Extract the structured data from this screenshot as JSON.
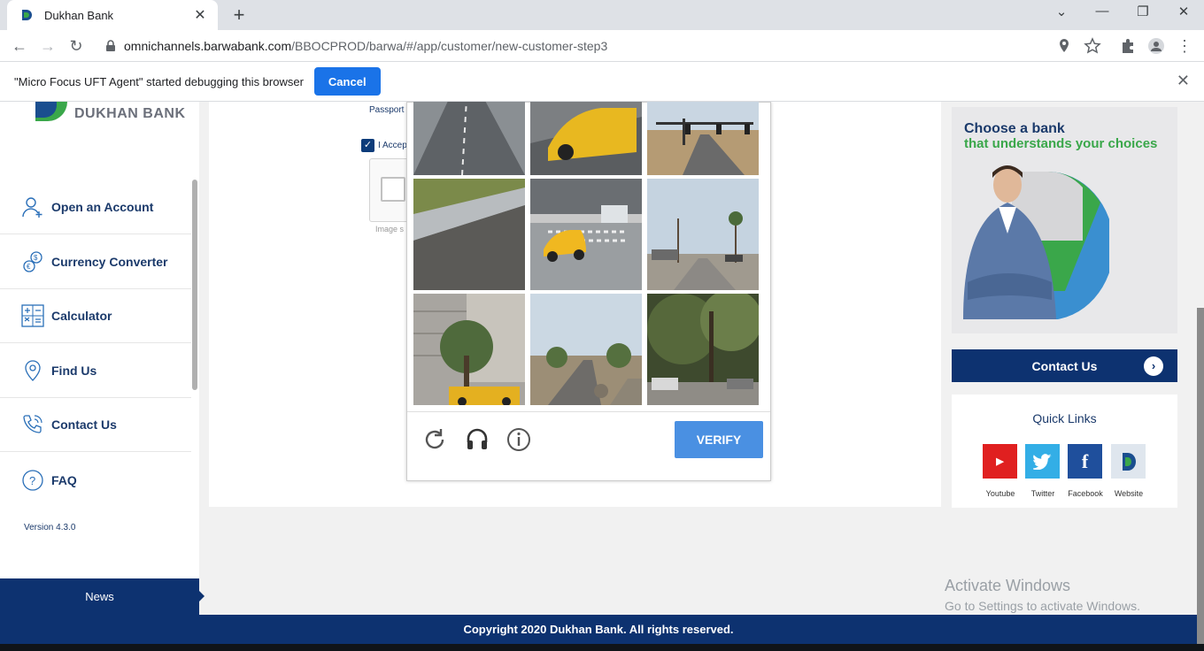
{
  "browser": {
    "tab_title": "Dukhan Bank",
    "url_host": "omnichannels.barwabank.com",
    "url_path": "/BBOCPROD/barwa/#/app/customer/new-customer-step3"
  },
  "infobar": {
    "message": "\"Micro Focus UFT Agent\" started debugging this browser",
    "cancel_label": "Cancel"
  },
  "sidebar": {
    "logo_text": "DUKHAN BANK",
    "items": [
      {
        "label": "Open an Account"
      },
      {
        "label": "Currency Converter"
      },
      {
        "label": "Calculator"
      },
      {
        "label": "Find Us"
      },
      {
        "label": "Contact Us"
      },
      {
        "label": "FAQ"
      }
    ],
    "version": "Version 4.3.0",
    "news_label": "News"
  },
  "form": {
    "passport_label": "Passport",
    "accept_label": "I Accep",
    "image_caption": "Image s"
  },
  "captcha": {
    "verify_label": "VERIFY"
  },
  "ad": {
    "line1": "Choose a bank",
    "line2": "that understands your choices"
  },
  "contact_button": "Contact Us",
  "quick_links": {
    "title": "Quick Links",
    "items": [
      {
        "label": "Youtube",
        "color": "#e02020"
      },
      {
        "label": "Twitter",
        "color": "#33aee6"
      },
      {
        "label": "Facebook",
        "color": "#1f4f9c"
      },
      {
        "label": "Website",
        "color": "#dfe6ee"
      }
    ]
  },
  "watermark": {
    "line1": "Activate Windows",
    "line2": "Go to Settings to activate Windows."
  },
  "footer": "Copyright 2020 Dukhan Bank. All rights reserved."
}
